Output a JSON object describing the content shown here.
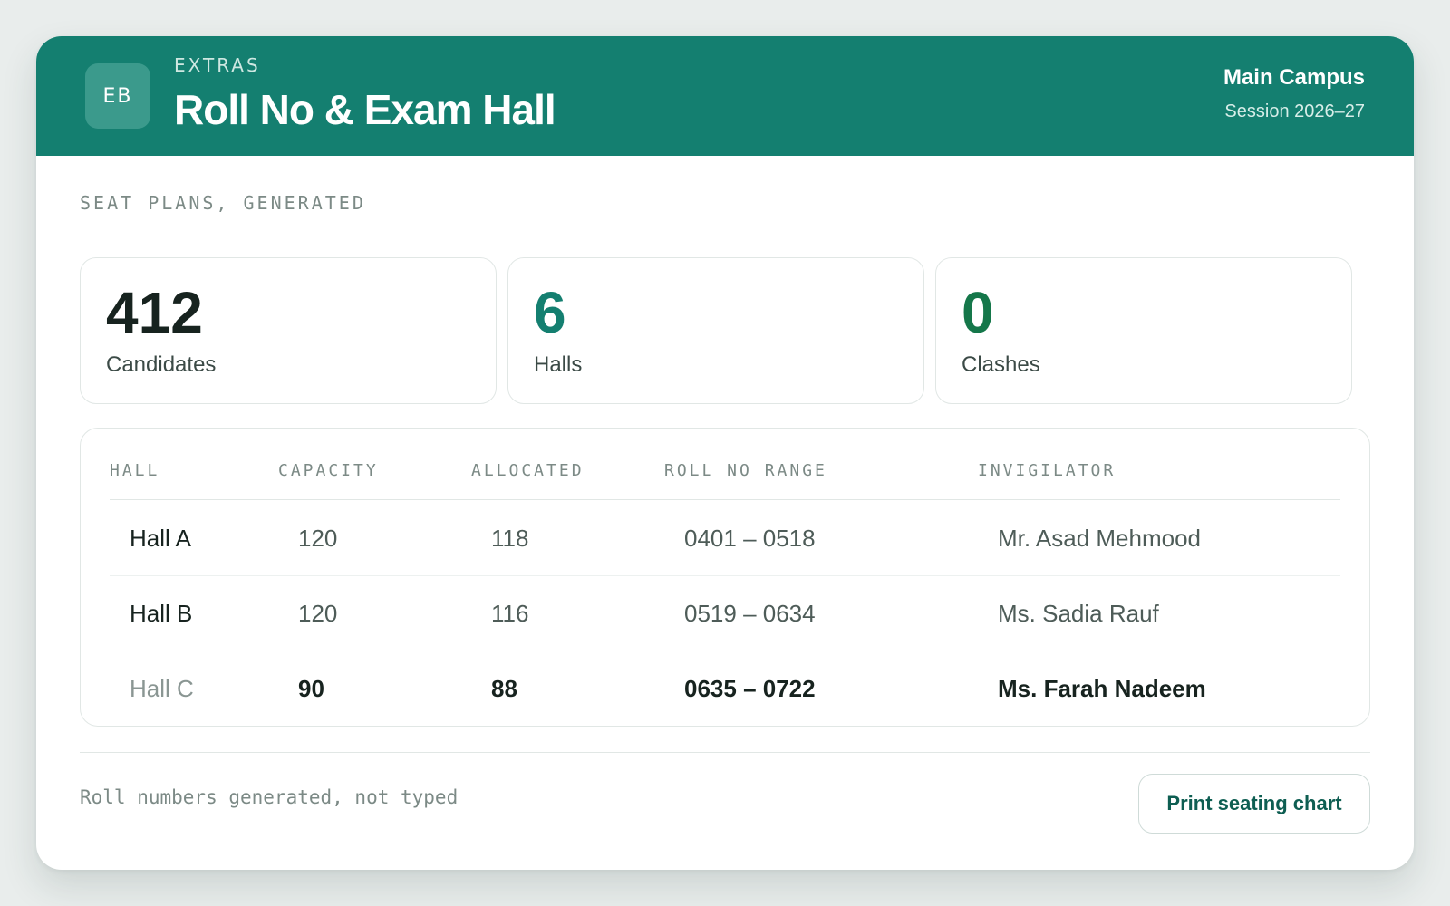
{
  "header": {
    "avatar": "EB",
    "eyebrow": "EXTRAS",
    "title": "Roll No & Exam Hall",
    "campus": "Main Campus",
    "session": "Session 2026–27"
  },
  "section_label": "SEAT PLANS, GENERATED",
  "stats": [
    {
      "value": "412",
      "label": "Candidates",
      "color": "#17231f"
    },
    {
      "value": "6",
      "label": "Halls",
      "color": "#147f70"
    },
    {
      "value": "0",
      "label": "Clashes",
      "color": "#15774a"
    }
  ],
  "table": {
    "columns": [
      "HALL",
      "CAPACITY",
      "ALLOCATED",
      "ROLL NO RANGE",
      "INVIGILATOR"
    ],
    "rows": [
      {
        "hall": "Hall A",
        "capacity": "120",
        "allocated": "118",
        "range": "0401 – 0518",
        "invigilator": "Mr. Asad Mehmood"
      },
      {
        "hall": "Hall B",
        "capacity": "120",
        "allocated": "116",
        "range": "0519 – 0634",
        "invigilator": "Ms. Sadia Rauf"
      },
      {
        "hall": "Hall C",
        "capacity": "90",
        "allocated": "88",
        "range": "0635 – 0722",
        "invigilator": "Ms. Farah Nadeem"
      }
    ]
  },
  "footer": {
    "note": "Roll numbers generated, not typed",
    "print_label": "Print seating chart"
  },
  "colors": {
    "brand": "#147f70",
    "accent_text": "#0e5e52"
  }
}
